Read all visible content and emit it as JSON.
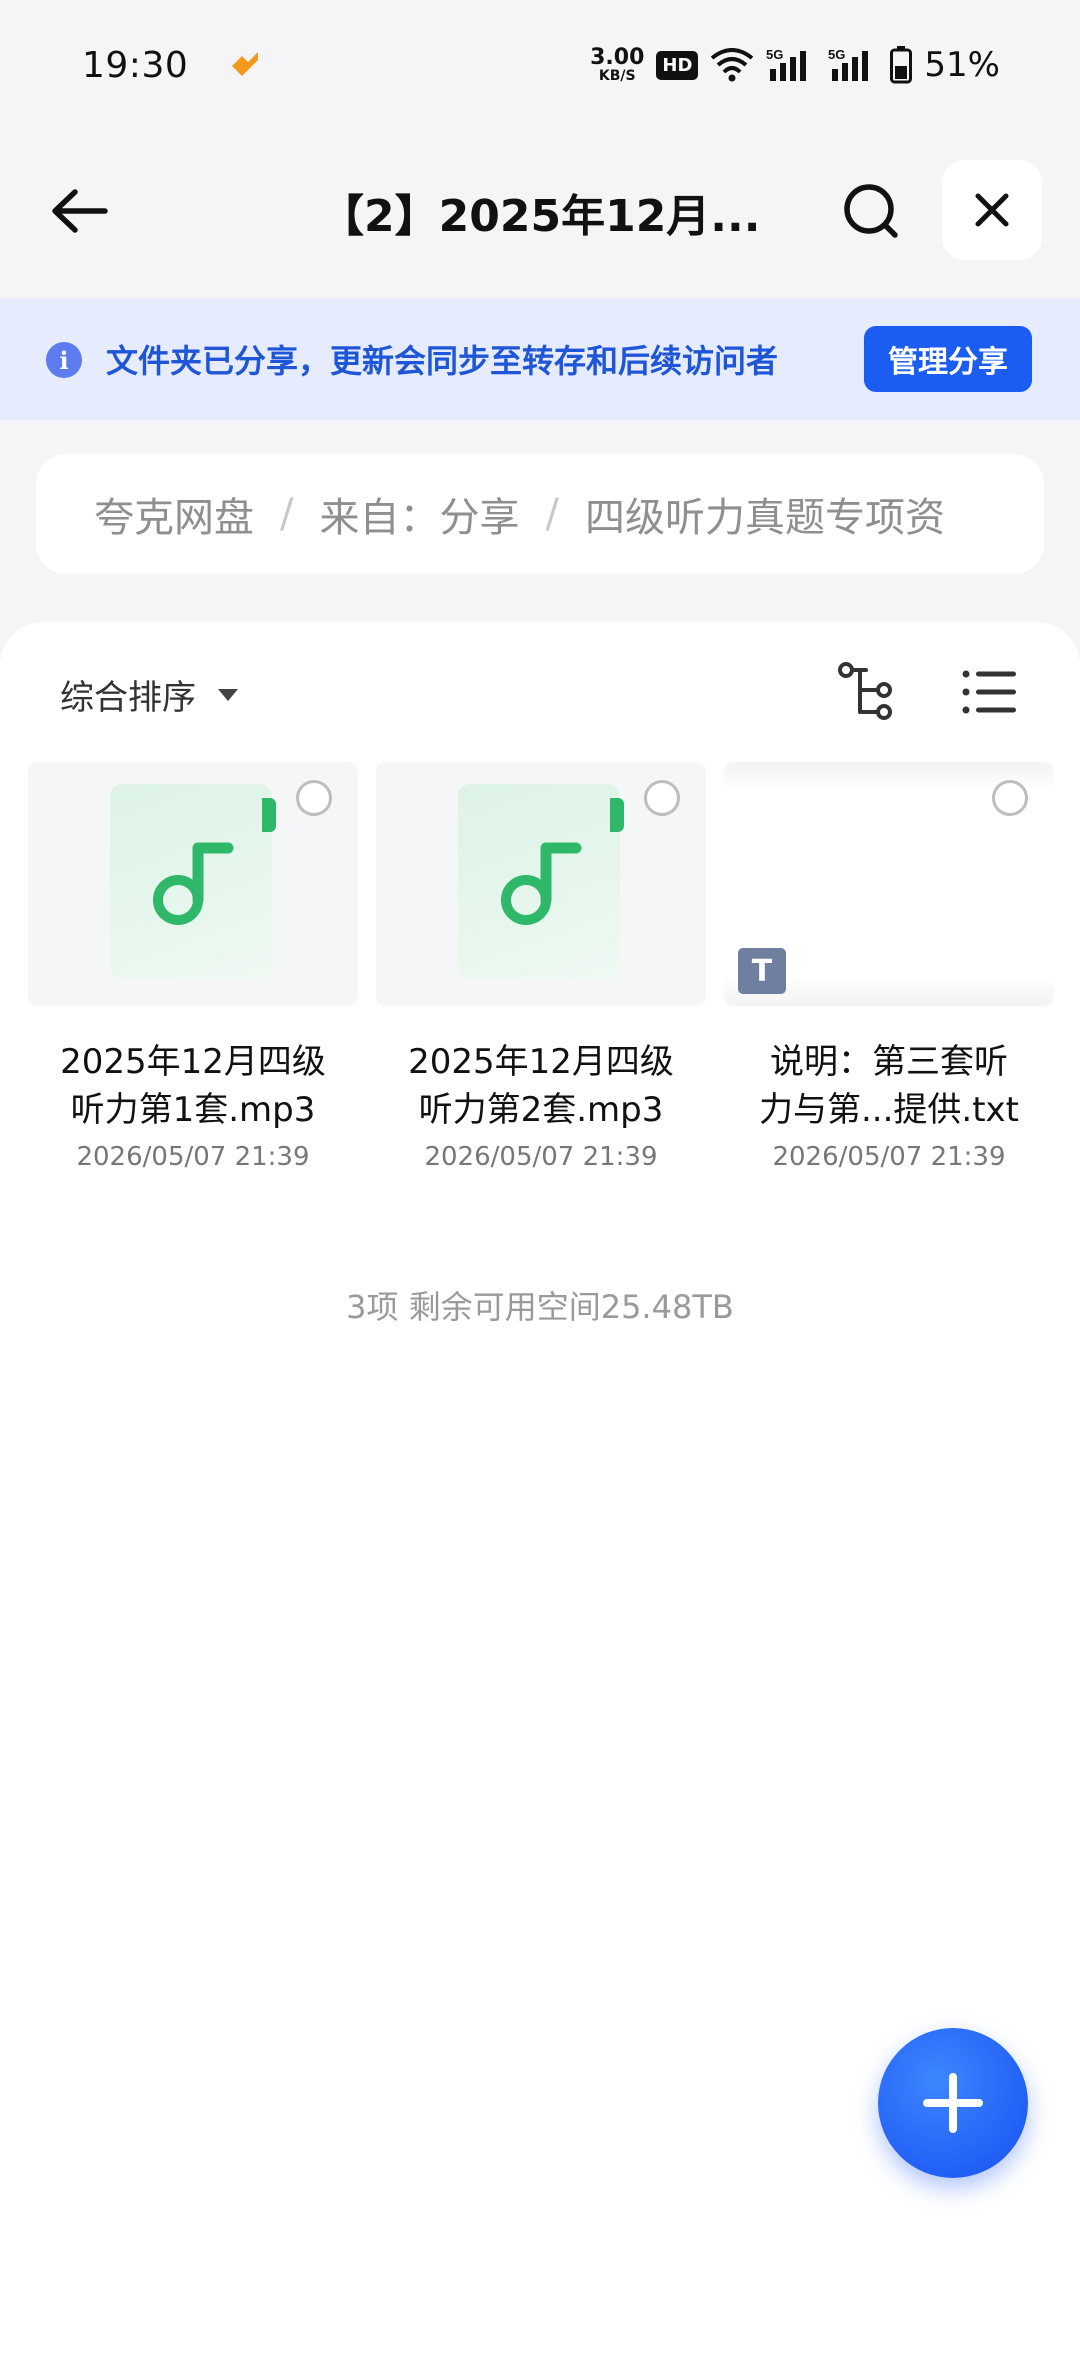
{
  "status_bar": {
    "time": "19:30",
    "net_speed_value": "3.00",
    "net_speed_unit": "KB/S",
    "hd_badge": "HD",
    "signal_1": "5G",
    "signal_2": "5G",
    "battery": "51%"
  },
  "header": {
    "title": "【2】2025年12月...",
    "back_icon": "arrow-left-icon",
    "search_icon": "search-icon",
    "close_icon": "close-icon"
  },
  "notice": {
    "text": "文件夹已分享，更新会同步至转存和后续访问者",
    "button": "管理分享",
    "icon": "info-icon"
  },
  "breadcrumb": {
    "items": [
      "夸克网盘",
      "来自：分享",
      "四级听力真题专项资"
    ],
    "separator": "/"
  },
  "toolbar": {
    "sort_label": "综合排序",
    "tree_icon": "tree-view-icon",
    "list_icon": "list-view-icon"
  },
  "files": [
    {
      "name_line1": "2025年12月四级",
      "name_line2": "听力第1套.mp3",
      "date": "2026/05/07 21:39",
      "type_icon": "music-file-icon"
    },
    {
      "name_line1": "2025年12月四级",
      "name_line2": "听力第2套.mp3",
      "date": "2026/05/07 21:39",
      "type_icon": "music-file-icon"
    },
    {
      "name_line1": "说明：第三套听",
      "name_line2": "力与第...提供.txt",
      "date": "2026/05/07 21:39",
      "type_icon": "text-file-icon",
      "badge": "T"
    }
  ],
  "footer": {
    "info": "3项 剩余可用空间25.48TB"
  },
  "colors": {
    "accent": "#1b5cf1",
    "notice_bg": "#e6ecfd",
    "music_green": "#2fb86a"
  }
}
